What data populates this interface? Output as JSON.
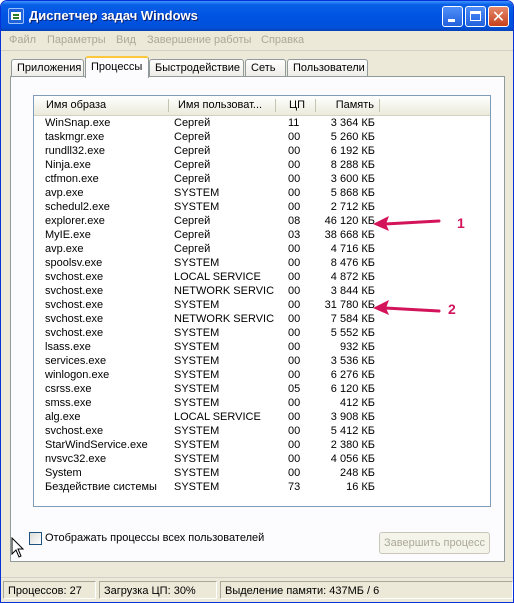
{
  "window": {
    "title": "Диспетчер задач Windows",
    "controls": {
      "minimize": "",
      "maximize": "",
      "close": "✕"
    }
  },
  "menu": [
    "Файл",
    "Параметры",
    "Вид",
    "Завершение работы",
    "Справка"
  ],
  "tabs": [
    {
      "label": "Приложения",
      "active": false
    },
    {
      "label": "Процессы",
      "active": true
    },
    {
      "label": "Быстродействие",
      "active": false
    },
    {
      "label": "Сеть",
      "active": false
    },
    {
      "label": "Пользователи",
      "active": false
    }
  ],
  "columns": {
    "name": "Имя образа",
    "user": "Имя пользоват...",
    "cpu": "ЦП",
    "mem": "Память"
  },
  "processes": [
    {
      "name": "WinSnap.exe",
      "user": "Сергей",
      "cpu": "11",
      "mem": "3 364 КБ"
    },
    {
      "name": "taskmgr.exe",
      "user": "Сергей",
      "cpu": "00",
      "mem": "5 260 КБ"
    },
    {
      "name": "rundll32.exe",
      "user": "Сергей",
      "cpu": "00",
      "mem": "6 192 КБ"
    },
    {
      "name": "Ninja.exe",
      "user": "Сергей",
      "cpu": "00",
      "mem": "8 288 КБ"
    },
    {
      "name": "ctfmon.exe",
      "user": "Сергей",
      "cpu": "00",
      "mem": "3 600 КБ"
    },
    {
      "name": "avp.exe",
      "user": "SYSTEM",
      "cpu": "00",
      "mem": "5 868 КБ"
    },
    {
      "name": "schedul2.exe",
      "user": "SYSTEM",
      "cpu": "00",
      "mem": "2 712 КБ"
    },
    {
      "name": "explorer.exe",
      "user": "Сергей",
      "cpu": "08",
      "mem": "46 120 КБ"
    },
    {
      "name": "MyIE.exe",
      "user": "Сергей",
      "cpu": "03",
      "mem": "38 668 КБ"
    },
    {
      "name": "avp.exe",
      "user": "Сергей",
      "cpu": "00",
      "mem": "4 716 КБ"
    },
    {
      "name": "spoolsv.exe",
      "user": "SYSTEM",
      "cpu": "00",
      "mem": "8 476 КБ"
    },
    {
      "name": "svchost.exe",
      "user": "LOCAL SERVICE",
      "cpu": "00",
      "mem": "4 872 КБ"
    },
    {
      "name": "svchost.exe",
      "user": "NETWORK SERVICE",
      "cpu": "00",
      "mem": "3 844 КБ"
    },
    {
      "name": "svchost.exe",
      "user": "SYSTEM",
      "cpu": "00",
      "mem": "31 780 КБ"
    },
    {
      "name": "svchost.exe",
      "user": "NETWORK SERVICE",
      "cpu": "00",
      "mem": "7 584 КБ"
    },
    {
      "name": "svchost.exe",
      "user": "SYSTEM",
      "cpu": "00",
      "mem": "5 552 КБ"
    },
    {
      "name": "lsass.exe",
      "user": "SYSTEM",
      "cpu": "00",
      "mem": "932 КБ"
    },
    {
      "name": "services.exe",
      "user": "SYSTEM",
      "cpu": "00",
      "mem": "3 536 КБ"
    },
    {
      "name": "winlogon.exe",
      "user": "SYSTEM",
      "cpu": "00",
      "mem": "6 276 КБ"
    },
    {
      "name": "csrss.exe",
      "user": "SYSTEM",
      "cpu": "05",
      "mem": "6 120 КБ"
    },
    {
      "name": "smss.exe",
      "user": "SYSTEM",
      "cpu": "00",
      "mem": "412 КБ"
    },
    {
      "name": "alg.exe",
      "user": "LOCAL SERVICE",
      "cpu": "00",
      "mem": "3 908 КБ"
    },
    {
      "name": "svchost.exe",
      "user": "SYSTEM",
      "cpu": "00",
      "mem": "5 412 КБ"
    },
    {
      "name": "StarWindService.exe",
      "user": "SYSTEM",
      "cpu": "00",
      "mem": "2 380 КБ"
    },
    {
      "name": "nvsvc32.exe",
      "user": "SYSTEM",
      "cpu": "00",
      "mem": "4 056 КБ"
    },
    {
      "name": "System",
      "user": "SYSTEM",
      "cpu": "00",
      "mem": "248 КБ"
    },
    {
      "name": "Бездействие системы",
      "user": "SYSTEM",
      "cpu": "73",
      "mem": "16 КБ"
    }
  ],
  "annotations": [
    {
      "label": "1",
      "color": "#d4145a"
    },
    {
      "label": "2",
      "color": "#d4145a"
    }
  ],
  "show_all_users": {
    "label": "Отображать процессы всех пользователей",
    "checked": false
  },
  "end_process_button": "Завершить процесс",
  "status": {
    "processes": "Процессов: 27",
    "cpu": "Загрузка ЦП: 30%",
    "memory": "Выделение памяти: 437МБ / 6"
  }
}
